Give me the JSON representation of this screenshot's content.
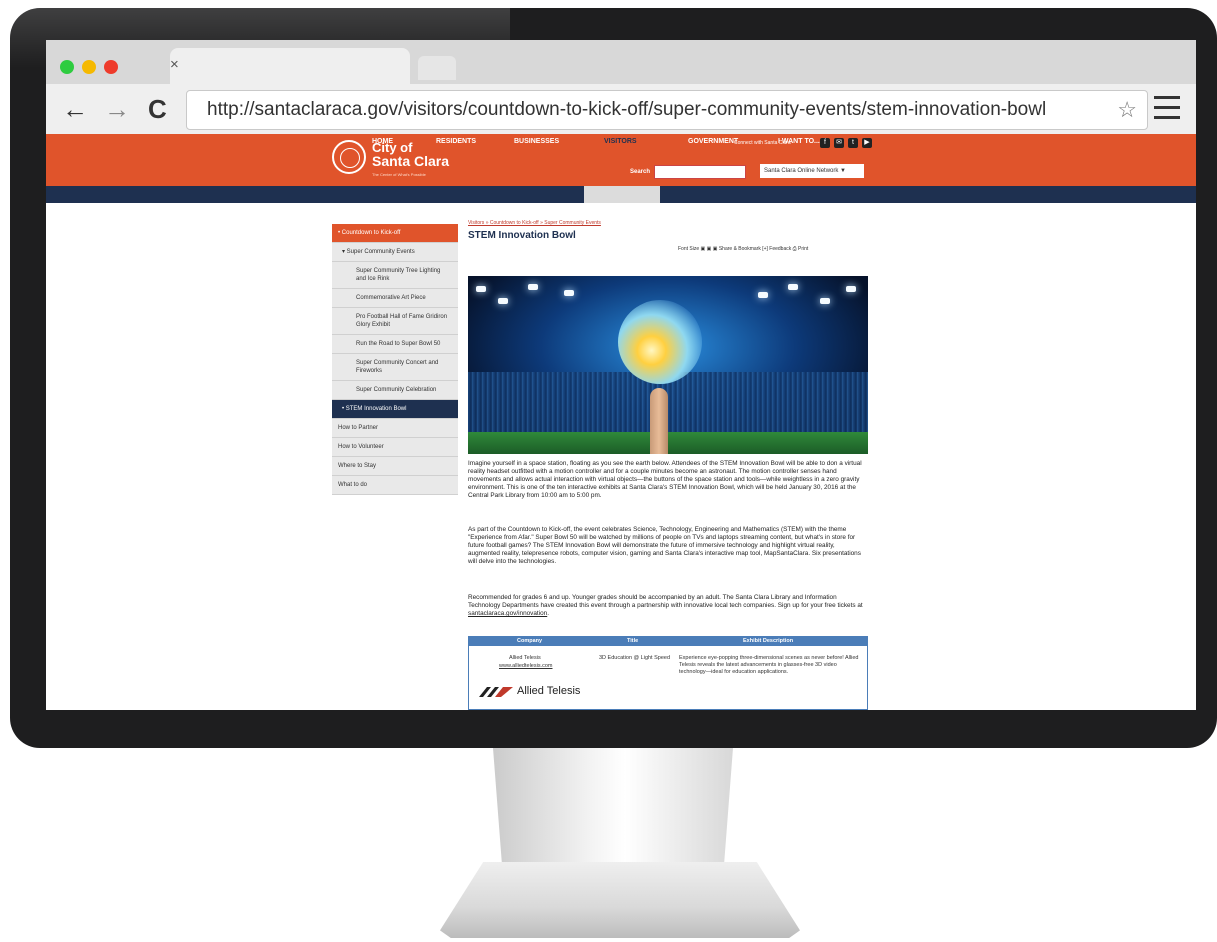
{
  "browser": {
    "tab_close": "×",
    "back": "←",
    "forward": "→",
    "reload": "C",
    "url": "http://santaclaraca.gov/visitors/countdown-to-kick-off/super-community-events/stem-innovation-bowl",
    "star": "☆"
  },
  "header": {
    "brand_line1": "City of",
    "brand_line2": "Santa Clara",
    "tagline": "The Center of What's Possible",
    "connect_label": "Connect with Santa Clara",
    "search_label": "Search",
    "network_select": "Santa Clara Online Network ▼"
  },
  "nav": [
    "HOME",
    "RESIDENTS",
    "BUSINESSES",
    "VISITORS",
    "GOVERNMENT",
    "I WANT TO..."
  ],
  "sidebar": [
    "• Countdown to Kick-off",
    "▾ Super Community Events",
    "Super Community Tree Lighting and Ice Rink",
    "Commemorative Art Piece",
    "Pro Football Hall of Fame Gridiron Glory Exhibit",
    "Run the Road to Super Bowl 50",
    "Super Community Concert and Fireworks",
    "Super Community Celebration",
    "• STEM Innovation Bowl",
    "How to Partner",
    "How to Volunteer",
    "Where to Stay",
    "What to do"
  ],
  "content": {
    "breadcrumb": "Visitors » Countdown to Kick-off » Super Community Events",
    "title": "STEM Innovation Bowl",
    "tools": "Font Size  ▣ ▣   ▣ Share & Bookmark   [+] Feedback   ⎙ Print",
    "p1": "Imagine yourself in a space station, floating as you see the earth below. Attendees of the STEM Innovation Bowl will be able to don a virtual reality headset outfitted with a motion controller and for a couple minutes become an astronaut. The motion controller senses hand movements and allows actual interaction with virtual objects—the buttons of the space station and tools—while weightless in a zero gravity environment. This is one of the ten interactive exhibits at Santa Clara's STEM Innovation Bowl, which will be held January 30, 2016 at the Central Park Library from 10:00 am to 5:00 pm.",
    "p2": "As part of the Countdown to Kick-off, the event celebrates Science, Technology, Engineering and Mathematics (STEM) with the theme \"Experience from Afar.\" Super Bowl 50 will be watched by millions of people on TVs and laptops streaming content, but what's in store for future football games? The STEM Innovation Bowl will demonstrate the future of immersive technology and highlight virtual reality, augmented reality, telepresence robots, computer vision, gaming and Santa Clara's interactive map tool, MapSantaClara. Six presentations will delve into the technologies.",
    "p3": "Recommended for grades 6 and up. Younger grades should be accompanied by an adult. The Santa Clara Library and Information Technology Departments have created this event through a partnership with innovative local tech companies. Sign up for your free tickets at",
    "p3_link": "santaclaraca.gov/innovation",
    "p3_end": "."
  },
  "exhibit_table": {
    "headers": [
      "Company",
      "Title",
      "Exhibit Description"
    ],
    "company": "Allied Telesis",
    "company_url": "www.alliedtelesis.com",
    "title": "3D Education @ Light Speed",
    "description": "Experience eye-popping three-dimensional scenes as never before! Allied Telesis reveals the latest advancements in glasses-free 3D video technology—ideal for education applications.",
    "logo_text": "Allied Telesis"
  }
}
